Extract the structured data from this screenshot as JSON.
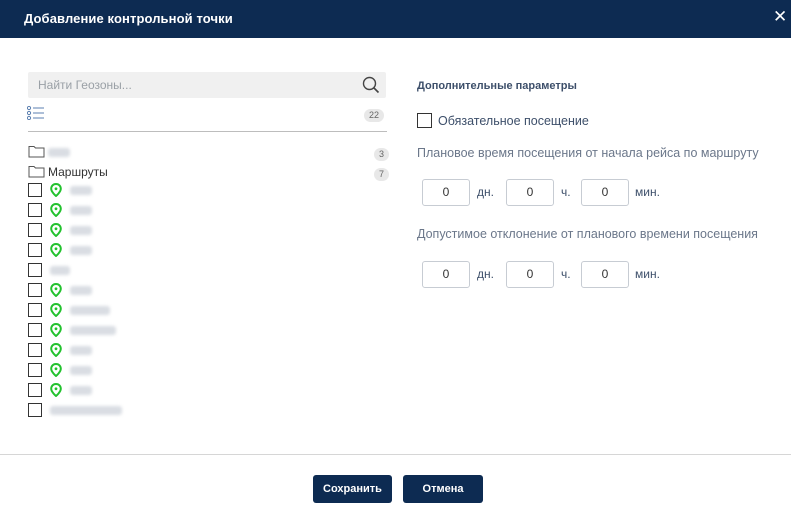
{
  "dialog": {
    "title": "Добавление контрольной точки"
  },
  "icons": {
    "close": "close-icon",
    "search": "search-icon",
    "list": "list-icon",
    "folder": "folder-icon",
    "pin": "map-pin-icon"
  },
  "colors": {
    "header": "#0d2b52",
    "pin": "#22c22e",
    "button": "#0d2b52"
  },
  "search": {
    "placeholder": "Найти Геозоны..."
  },
  "list_badge": "22",
  "folders": [
    {
      "label": "",
      "count": "3"
    },
    {
      "label": "Маршруты",
      "count": "7"
    }
  ],
  "geozones": [
    {
      "has_pin": true
    },
    {
      "has_pin": true
    },
    {
      "has_pin": true
    },
    {
      "has_pin": true
    },
    {
      "has_pin": false
    },
    {
      "has_pin": true
    },
    {
      "has_pin": true
    },
    {
      "has_pin": true
    },
    {
      "has_pin": true
    },
    {
      "has_pin": true
    },
    {
      "has_pin": true
    },
    {
      "has_pin": false
    }
  ],
  "params": {
    "title": "Дополнительные параметры",
    "mandatory_label": "Обязательное посещение",
    "planned": {
      "label": "Плановое время посещения от начала рейса по маршруту",
      "days": "0",
      "hours": "0",
      "minutes": "0"
    },
    "deviation": {
      "label": "Допустимое отклонение от планового времени посещения",
      "days": "0",
      "hours": "0",
      "minutes": "0"
    },
    "units": {
      "days": "дн.",
      "hours": "ч.",
      "minutes": "мин."
    }
  },
  "footer": {
    "save_label": "Сохранить",
    "cancel_label": "Отмена"
  }
}
